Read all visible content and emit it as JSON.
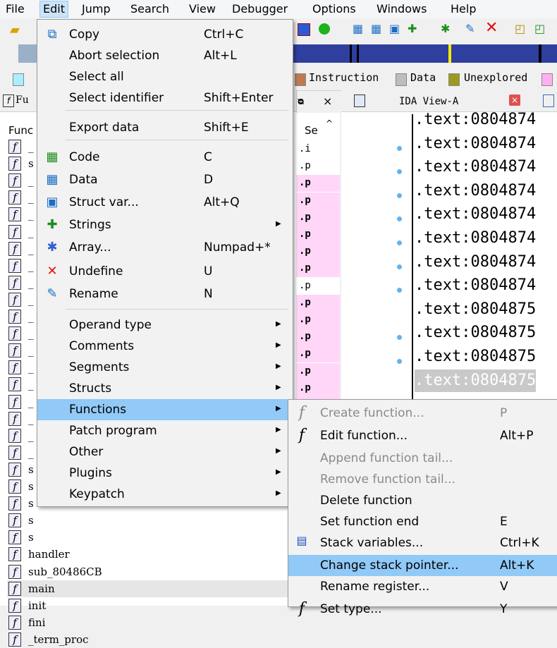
{
  "menubar": [
    "File",
    "Edit",
    "Jump",
    "Search",
    "View",
    "Debugger",
    "Options",
    "Windows",
    "Help"
  ],
  "legend": {
    "instruction": "Instruction",
    "data": "Data",
    "unexplored": "Unexplored"
  },
  "colors": {
    "instruction": "#c07a52",
    "data": "#bdbdbd",
    "unexplored": "#9a9a1e",
    "lib": "#aaeeff",
    "pink": "#ffb0f0",
    "highlight": "#91c9f7"
  },
  "funcpane": {
    "tab_label": "Fu",
    "header": "Func",
    "close": "×",
    "rows": [
      "_",
      "s",
      "_",
      "_",
      "_",
      "_",
      "_",
      "_",
      "_",
      "_",
      "_",
      "_",
      "_",
      "_",
      "_",
      "_",
      "_",
      "_",
      "_",
      "s",
      "s",
      "s",
      "s",
      "s",
      "handler",
      "sub_80486CB",
      "main",
      "init",
      "fini",
      "_term_proc"
    ]
  },
  "segments": {
    "header": "Se",
    "values": [
      ".i",
      ".p",
      ".p",
      ".p",
      ".p",
      ".p",
      ".p",
      ".p",
      ".p",
      ".p",
      ".p",
      ".p",
      ".p",
      ".p",
      ".p",
      ".p"
    ]
  },
  "idaview": {
    "tab_label": "IDA View-A",
    "lines": [
      ".text:0804874",
      ".text:0804874",
      ".text:0804874",
      ".text:0804874",
      ".text:0804874",
      ".text:0804874",
      ".text:0804874",
      ".text:0804874",
      ".text:0804875",
      ".text:0804875",
      ".text:0804875",
      ".text:0804875"
    ]
  },
  "edit_menu": {
    "items": [
      {
        "label": "Copy",
        "accel": "Ctrl+C",
        "icon": "copy-icon"
      },
      {
        "label": "Abort selection",
        "accel": "Alt+L"
      },
      {
        "label": "Select all",
        "accel": ""
      },
      {
        "label": "Select identifier",
        "accel": "Shift+Enter"
      },
      {
        "label": "Export data",
        "accel": "Shift+E"
      },
      {
        "label": "Code",
        "accel": "C",
        "icon": "code-icon"
      },
      {
        "label": "Data",
        "accel": "D",
        "icon": "data-icon"
      },
      {
        "label": "Struct var...",
        "accel": "Alt+Q",
        "icon": "struct-icon"
      },
      {
        "label": "Strings",
        "accel": "",
        "submenu": true,
        "icon": "strings-icon"
      },
      {
        "label": "Array...",
        "accel": "Numpad+*",
        "icon": "array-icon"
      },
      {
        "label": "Undefine",
        "accel": "U",
        "icon": "undefine-icon"
      },
      {
        "label": "Rename",
        "accel": "N",
        "icon": "rename-icon"
      },
      {
        "label": "Operand type",
        "submenu": true
      },
      {
        "label": "Comments",
        "submenu": true
      },
      {
        "label": "Segments",
        "submenu": true
      },
      {
        "label": "Structs",
        "submenu": true
      },
      {
        "label": "Functions",
        "submenu": true
      },
      {
        "label": "Patch program",
        "submenu": true
      },
      {
        "label": "Other",
        "submenu": true
      },
      {
        "label": "Plugins",
        "submenu": true
      },
      {
        "label": "Keypatch",
        "submenu": true
      }
    ]
  },
  "functions_submenu": {
    "items": [
      {
        "label": "Create function...",
        "accel": "P",
        "disabled": true,
        "icon": "function-icon"
      },
      {
        "label": "Edit function...",
        "accel": "Alt+P",
        "icon": "function-icon"
      },
      {
        "label": "Append function tail...",
        "accel": "",
        "disabled": true
      },
      {
        "label": "Remove function tail...",
        "accel": "",
        "disabled": true
      },
      {
        "label": "Delete function",
        "accel": ""
      },
      {
        "label": "Set function end",
        "accel": "E"
      },
      {
        "label": "Stack variables...",
        "accel": "Ctrl+K",
        "icon": "stack-vars-icon"
      },
      {
        "label": "Change stack pointer...",
        "accel": "Alt+K"
      },
      {
        "label": "Rename register...",
        "accel": "V"
      },
      {
        "label": "Set type...",
        "accel": "Y",
        "icon": "function-icon"
      }
    ]
  }
}
